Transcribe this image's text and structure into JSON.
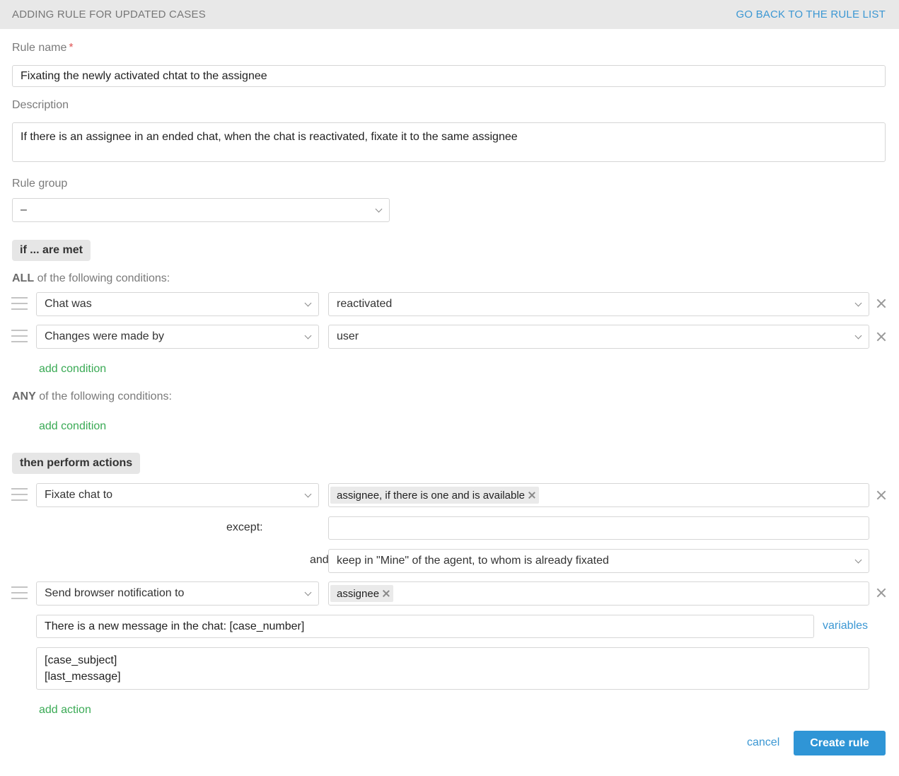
{
  "header": {
    "title": "ADDING RULE FOR UPDATED CASES",
    "back_link": "GO BACK TO THE RULE LIST"
  },
  "form": {
    "rule_name_label": "Rule name",
    "required_mark": "*",
    "rule_name_value": "Fixating the newly activated chtat to the assignee",
    "description_label": "Description",
    "description_value": "If there is an assignee in an ended chat, when the chat is reactivated, fixate it to the same assignee",
    "rule_group_label": "Rule group",
    "rule_group_value": "–"
  },
  "conditions": {
    "section_label": "if ... are met",
    "all_keyword": "ALL",
    "all_suffix": "of the following conditions:",
    "all_items": [
      {
        "field": "Chat was",
        "value": "reactivated"
      },
      {
        "field": "Changes were made by",
        "value": "user"
      }
    ],
    "add_condition": "add condition",
    "any_keyword": "ANY",
    "any_suffix": "of the following conditions:"
  },
  "actions": {
    "section_label": "then perform actions",
    "items": [
      {
        "action": "Fixate chat to",
        "tag": "assignee, if there is one and is available",
        "except_label": "except:",
        "except_value": "",
        "and_label": "and",
        "and_value": "keep in \"Mine\" of the agent, to whom is already fixated"
      },
      {
        "action": "Send browser notification to",
        "tag": "assignee",
        "subject": "There is a new message in the chat: [case_number]",
        "variables_link": "variables",
        "body": "[case_subject]\n[last_message]"
      }
    ],
    "add_action": "add action"
  },
  "footer": {
    "cancel": "cancel",
    "create": "Create rule"
  },
  "colors": {
    "accent_blue": "#2f95d6",
    "link_green": "#3aaa55",
    "header_bg": "#e8e8e8"
  }
}
